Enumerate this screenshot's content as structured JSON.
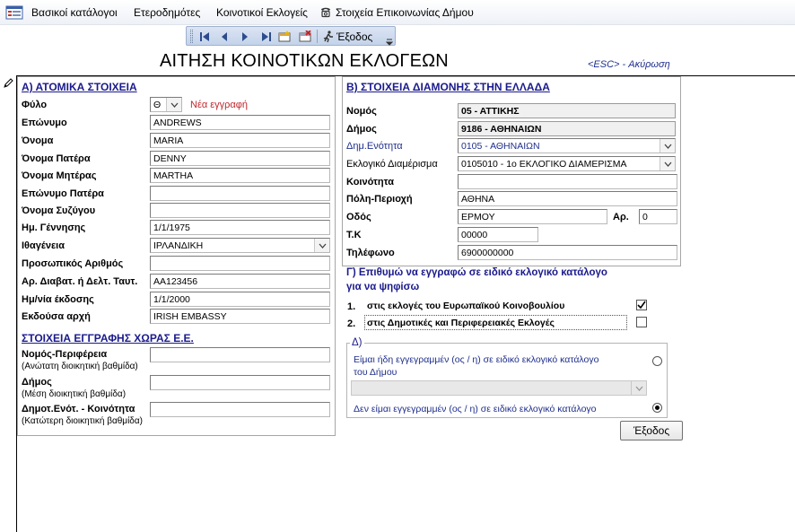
{
  "menu": {
    "items": [
      "Βασικοί κατάλογοι",
      "Ετεροδημότες",
      "Κοινοτικοί Εκλογείς",
      "Στοιχεία Επικοινωνίας Δήμου"
    ],
    "exit_label": "Έξοδος"
  },
  "form": {
    "title": "ΑΙΤΗΣΗ ΚΟΙΝΟΤΙΚΩΝ ΕΚΛΟΓΕΩΝ",
    "esc_hint": "<ESC> - Ακύρωση"
  },
  "section_a": {
    "title": "Α) ΑΤΟΜΙΚΑ ΣΤΟΙΧΕΙΑ",
    "gender_label": "Φύλο",
    "gender_value": "Θ",
    "new_record": "Νέα εγγραφή",
    "fields": [
      {
        "label": "Επώνυμο",
        "value": "ANDREWS"
      },
      {
        "label": "Όνομα",
        "value": "MARIA"
      },
      {
        "label": "Όνομα Πατέρα",
        "value": "DENNY"
      },
      {
        "label": "Όνομα Μητέρας",
        "value": "MARTHA"
      },
      {
        "label": "Επώνυμο Πατέρα",
        "value": ""
      },
      {
        "label": "Όνομα Συζύγου",
        "value": ""
      },
      {
        "label": "Ημ. Γέννησης",
        "value": "1/1/1975"
      },
      {
        "label": "Ιθαγένεια",
        "value": "ΙΡΛΑΝΔΙΚΗ"
      },
      {
        "label": "Προσωπικός Αριθμός",
        "value": ""
      },
      {
        "label": "Αρ. Διαβατ. ή Δελτ. Ταυτ.",
        "value": "AA123456"
      },
      {
        "label": "Ημ/νία έκδοσης",
        "value": "1/1/2000"
      },
      {
        "label": "Εκδούσα αρχή",
        "value": "IRISH EMBASSY"
      }
    ]
  },
  "section_eu": {
    "title": "ΣΤΟΙΧΕΙΑ ΕΓΓΡΑΦΗΣ ΧΩΡΑΣ Ε.Ε.",
    "rows": [
      {
        "label": "Νομός-Περιφέρεια",
        "sub": "(Ανώτατη διοικητική βαθμίδα)",
        "value": ""
      },
      {
        "label": "Δήμος",
        "sub": "(Μέση διοικητική βαθμίδα)",
        "value": ""
      },
      {
        "label": "Δημοτ.Ενότ. - Κοινότητα",
        "sub": "(Κατώτερη διοικητική βαθμίδα)",
        "value": ""
      }
    ]
  },
  "section_b": {
    "title": "Β) ΣΤΟΙΧΕΙΑ ΔΙΑΜΟΝΗΣ ΣΤΗΝ ΕΛΛΑΔΑ",
    "nomos_label": "Νομός",
    "nomos_value": "05 - ΑΤΤΙΚΗΣ",
    "dimos_label": "Δήμος",
    "dimos_value": "9186 - ΑΘΗΝΑΙΩΝ",
    "enotita_label": "Δημ.Ενότητα",
    "enotita_value": "0105 - ΑΘΗΝΑΙΩΝ",
    "diamerisma_label": "Εκλογικό Διαμέρισμα",
    "diamerisma_value": "0105010 - 1ο ΕΚΛΟΓΙΚΟ ΔΙΑΜΕΡΙΣΜΑ",
    "koinotita_label": "Κοινότητα",
    "koinotita_value": "",
    "poli_label": "Πόλη-Περιοχή",
    "poli_value": "ΑΘΗΝΑ",
    "odos_label": "Οδός",
    "odos_value": "ΕΡΜΟΥ",
    "arithmos_label": "Αρ.",
    "arithmos_value": "0",
    "tk_label": "Τ.Κ",
    "tk_value": "00000",
    "tilefono_label": "Τηλέφωνο",
    "tilefono_value": "6900000000"
  },
  "section_c": {
    "title_line1": "Γ) Επιθυμώ να εγγραφώ σε ειδικό εκλογικό κατάλογο",
    "title_line2": "για να ψηφίσω",
    "options": [
      {
        "num": "1.",
        "label": "στις εκλογές του Ευρωπαϊκού Κοινοβουλίου",
        "checked": true
      },
      {
        "num": "2.",
        "label": "στις Δημοτικές και Περιφερειακές Εκλογές",
        "checked": false
      }
    ]
  },
  "section_d": {
    "title": "Δ)",
    "option1_line1": "Είμαι ήδη εγγεγραμμέν (ος / η) σε ειδικό εκλογικό κατάλογο",
    "option1_line2": "του Δήμου",
    "option1_selected": false,
    "dropdown_value": "",
    "option2": "Δεν είμαι εγγεγραμμέν (ος / η) σε ειδικό εκλογικό κατάλογο",
    "option2_selected": true
  },
  "buttons": {
    "exit": "Έξοδος"
  }
}
